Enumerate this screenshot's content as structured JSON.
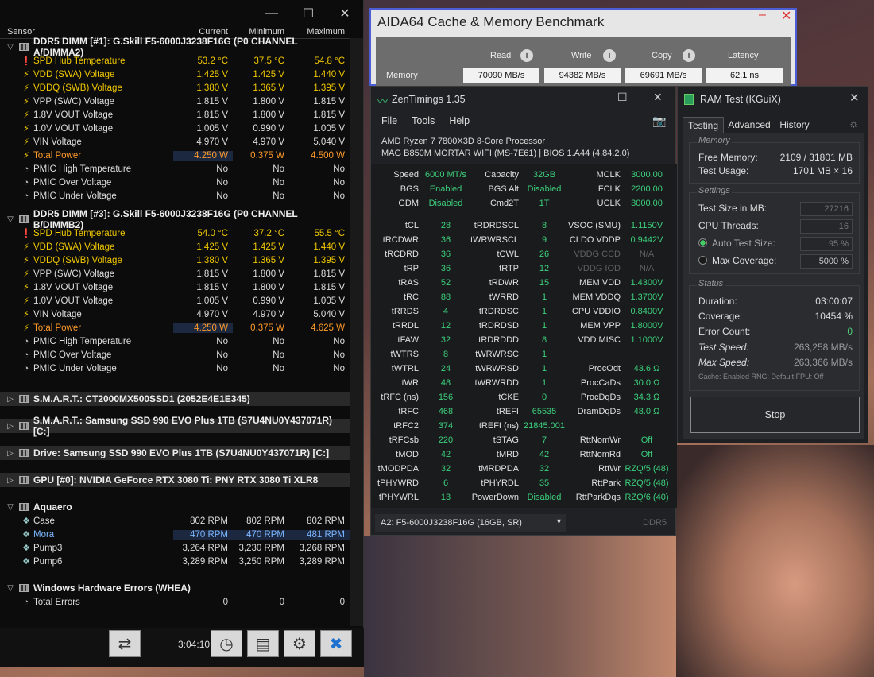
{
  "hwinfo": {
    "columns": [
      "Sensor",
      "Current",
      "Minimum",
      "Maximum"
    ],
    "groups": [
      {
        "title": "DDR5 DIMM [#1]: G.Skill F5-6000J3238F16G (P0 CHANNEL A/DIMMA2)",
        "rows": [
          {
            "name": "SPD Hub Temperature",
            "cur": "53.2 °C",
            "min": "37.5 °C",
            "max": "54.8 °C"
          },
          {
            "name": "VDD (SWA) Voltage",
            "cur": "1.425 V",
            "min": "1.425 V",
            "max": "1.440 V"
          },
          {
            "name": "VDDQ (SWB) Voltage",
            "cur": "1.380 V",
            "min": "1.365 V",
            "max": "1.395 V"
          },
          {
            "name": "VPP (SWC) Voltage",
            "cur": "1.815 V",
            "min": "1.800 V",
            "max": "1.815 V"
          },
          {
            "name": "1.8V VOUT Voltage",
            "cur": "1.815 V",
            "min": "1.800 V",
            "max": "1.815 V"
          },
          {
            "name": "1.0V VOUT Voltage",
            "cur": "1.005 V",
            "min": "0.990 V",
            "max": "1.005 V"
          },
          {
            "name": "VIN Voltage",
            "cur": "4.970 V",
            "min": "4.970 V",
            "max": "5.040 V"
          },
          {
            "name": "Total Power",
            "cur": "4.250 W",
            "min": "0.375 W",
            "max": "4.500 W"
          },
          {
            "name": "PMIC High Temperature",
            "cur": "No",
            "min": "No",
            "max": "No"
          },
          {
            "name": "PMIC Over Voltage",
            "cur": "No",
            "min": "No",
            "max": "No"
          },
          {
            "name": "PMIC Under Voltage",
            "cur": "No",
            "min": "No",
            "max": "No"
          }
        ]
      },
      {
        "title": "DDR5 DIMM [#3]: G.Skill F5-6000J3238F16G (P0 CHANNEL B/DIMMB2)",
        "rows": [
          {
            "name": "SPD Hub Temperature",
            "cur": "54.0 °C",
            "min": "37.2 °C",
            "max": "55.5 °C"
          },
          {
            "name": "VDD (SWA) Voltage",
            "cur": "1.425 V",
            "min": "1.425 V",
            "max": "1.440 V"
          },
          {
            "name": "VDDQ (SWB) Voltage",
            "cur": "1.380 V",
            "min": "1.365 V",
            "max": "1.395 V"
          },
          {
            "name": "VPP (SWC) Voltage",
            "cur": "1.815 V",
            "min": "1.800 V",
            "max": "1.815 V"
          },
          {
            "name": "1.8V VOUT Voltage",
            "cur": "1.815 V",
            "min": "1.800 V",
            "max": "1.815 V"
          },
          {
            "name": "1.0V VOUT Voltage",
            "cur": "1.005 V",
            "min": "0.990 V",
            "max": "1.005 V"
          },
          {
            "name": "VIN Voltage",
            "cur": "4.970 V",
            "min": "4.970 V",
            "max": "5.040 V"
          },
          {
            "name": "Total Power",
            "cur": "4.250 W",
            "min": "0.375 W",
            "max": "4.625 W"
          },
          {
            "name": "PMIC High Temperature",
            "cur": "No",
            "min": "No",
            "max": "No"
          },
          {
            "name": "PMIC Over Voltage",
            "cur": "No",
            "min": "No",
            "max": "No"
          },
          {
            "name": "PMIC Under Voltage",
            "cur": "No",
            "min": "No",
            "max": "No"
          }
        ]
      }
    ],
    "collapsed": [
      "S.M.A.R.T.: CT2000MX500SSD1 (2052E4E1E345)",
      "S.M.A.R.T.: Samsung SSD 990 EVO Plus 1TB (S7U4NU0Y437071R) [C:]",
      "Drive: Samsung SSD 990 EVO Plus 1TB (S7U4NU0Y437071R) [C:]",
      "GPU [#0]: NVIDIA GeForce RTX 3080 Ti: PNY RTX 3080 Ti XLR8"
    ],
    "aquaero": {
      "title": "Aquaero",
      "rows": [
        {
          "name": "Case",
          "cur": "802 RPM",
          "min": "802 RPM",
          "max": "802 RPM"
        },
        {
          "name": "Mora",
          "cur": "470 RPM",
          "min": "470 RPM",
          "max": "481 RPM"
        },
        {
          "name": "Pump3",
          "cur": "3,264 RPM",
          "min": "3,230 RPM",
          "max": "3,268 RPM"
        },
        {
          "name": "Pump6",
          "cur": "3,289 RPM",
          "min": "3,250 RPM",
          "max": "3,289 RPM"
        }
      ]
    },
    "whea": {
      "title": "Windows Hardware Errors (WHEA)",
      "rows": [
        {
          "name": "Total Errors",
          "cur": "0",
          "min": "0",
          "max": "0"
        }
      ]
    },
    "timer": "3:04:10"
  },
  "aida": {
    "title": "AIDA64 Cache & Memory Benchmark",
    "headers": [
      "Read",
      "Write",
      "Copy",
      "Latency"
    ],
    "row_label": "Memory",
    "values": [
      "70090 MB/s",
      "94382 MB/s",
      "69691 MB/s",
      "62.1 ns"
    ]
  },
  "zen": {
    "title": "ZenTimings 1.35",
    "menu": [
      "File",
      "Tools",
      "Help"
    ],
    "cpu": "AMD Ryzen 7 7800X3D 8-Core Processor",
    "board": "MAG B850M MORTAR WIFI (MS-7E61) | BIOS 1.A44 (4.84.2.0)",
    "top": [
      [
        "Speed",
        "6000 MT/s",
        "Capacity",
        "32GB",
        "MCLK",
        "3000.00"
      ],
      [
        "BGS",
        "Enabled",
        "BGS Alt",
        "Disabled",
        "FCLK",
        "2200.00"
      ],
      [
        "GDM",
        "Disabled",
        "Cmd2T",
        "1T",
        "UCLK",
        "3000.00"
      ]
    ],
    "timings": [
      [
        "tCL",
        "28",
        "tRDRDSCL",
        "8",
        "VSOC (SMU)",
        "1.1150V"
      ],
      [
        "tRCDWR",
        "36",
        "tWRWRSCL",
        "9",
        "CLDO VDDP",
        "0.9442V"
      ],
      [
        "tRCDRD",
        "36",
        "tCWL",
        "26",
        "VDDG CCD",
        "N/A"
      ],
      [
        "tRP",
        "36",
        "tRTP",
        "12",
        "VDDG IOD",
        "N/A"
      ],
      [
        "tRAS",
        "52",
        "tRDWR",
        "15",
        "MEM VDD",
        "1.4300V"
      ],
      [
        "tRC",
        "88",
        "tWRRD",
        "1",
        "MEM VDDQ",
        "1.3700V"
      ],
      [
        "tRRDS",
        "4",
        "tRDRDSC",
        "1",
        "CPU VDDIO",
        "0.8400V"
      ],
      [
        "tRRDL",
        "12",
        "tRDRDSD",
        "1",
        "MEM VPP",
        "1.8000V"
      ],
      [
        "tFAW",
        "32",
        "tRDRDDD",
        "8",
        "VDD MISC",
        "1.1000V"
      ],
      [
        "tWTRS",
        "8",
        "tWRWRSC",
        "1",
        "",
        ""
      ],
      [
        "tWTRL",
        "24",
        "tWRWRSD",
        "1",
        "ProcOdt",
        "43.6 Ω"
      ],
      [
        "tWR",
        "48",
        "tWRWRDD",
        "1",
        "ProcCaDs",
        "30.0 Ω"
      ],
      [
        "tRFC (ns)",
        "156",
        "tCKE",
        "0",
        "ProcDqDs",
        "34.3 Ω"
      ],
      [
        "tRFC",
        "468",
        "tREFI",
        "65535",
        "DramDqDs",
        "48.0 Ω"
      ],
      [
        "tRFC2",
        "374",
        "tREFI (ns)",
        "21845.001",
        "",
        ""
      ],
      [
        "tRFCsb",
        "220",
        "tSTAG",
        "7",
        "RttNomWr",
        "Off"
      ],
      [
        "tMOD",
        "42",
        "tMRD",
        "42",
        "RttNomRd",
        "Off"
      ],
      [
        "tMODPDA",
        "32",
        "tMRDPDA",
        "32",
        "RttWr",
        "RZQ/5 (48)"
      ],
      [
        "tPHYWRD",
        "6",
        "tPHYRDL",
        "35",
        "RttPark",
        "RZQ/5 (48)"
      ],
      [
        "tPHYWRL",
        "13",
        "PowerDown",
        "Disabled",
        "RttParkDqs",
        "RZQ/6 (40)"
      ]
    ],
    "dimm": "A2: F5-6000J3238F16G (16GB, SR)",
    "type": "DDR5"
  },
  "ram": {
    "title": "RAM Test (KGuiX)",
    "tabs": [
      "Testing",
      "Advanced",
      "History"
    ],
    "memory_label": "Memory",
    "free_label": "Free Memory:",
    "free": "2109 / 31801 MB",
    "usage_label": "Test Usage:",
    "usage": "1701 MB × 16",
    "settings_label": "Settings",
    "size_label": "Test Size in MB:",
    "size": "27216",
    "threads_label": "CPU Threads:",
    "threads": "16",
    "auto_label": "Auto Test Size:",
    "auto": "95 %",
    "maxcov_label": "Max Coverage:",
    "maxcov": "5000 %",
    "status_label": "Status",
    "duration_label": "Duration:",
    "duration": "03:00:07",
    "coverage_label": "Coverage:",
    "coverage": "10454 %",
    "errors_label": "Error Count:",
    "errors": "0",
    "speed_label": "Test Speed:",
    "speed": "263,258 MB/s",
    "maxspeed_label": "Max Speed:",
    "maxspeed": "263,366 MB/s",
    "footer": "Cache: Enabled  RNG: Default  FPU: Off",
    "stop": "Stop"
  }
}
